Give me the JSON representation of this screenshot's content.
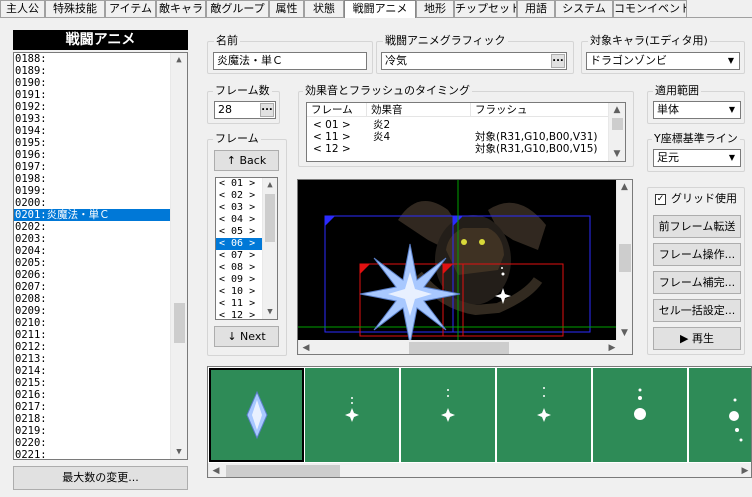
{
  "tabs": [
    "主人公",
    "特殊技能",
    "アイテム",
    "敵キャラ",
    "敵グループ",
    "属性",
    "状態",
    "戦闘アニメ",
    "地形",
    "チップセット",
    "用語",
    "システム",
    "コモンイベント"
  ],
  "active_tab": "戦闘アニメ",
  "left": {
    "title": "戦闘アニメ",
    "items": [
      "0188:",
      "0189:",
      "0190:",
      "0191:",
      "0192:",
      "0193:",
      "0194:",
      "0195:",
      "0196:",
      "0197:",
      "0198:",
      "0199:",
      "0200:",
      "0201:炎魔法・単Ｃ",
      "0202:",
      "0203:",
      "0204:",
      "0205:",
      "0206:",
      "0207:",
      "0208:",
      "0209:",
      "0210:",
      "0211:",
      "0212:",
      "0213:",
      "0214:",
      "0215:",
      "0216:",
      "0217:",
      "0218:",
      "0219:",
      "0220:",
      "0221:"
    ],
    "selected_index": 13,
    "max_button": "最大数の変更..."
  },
  "name": {
    "label": "名前",
    "value": "炎魔法・単Ｃ"
  },
  "graphic": {
    "label": "戦闘アニメグラフィック",
    "value": "冷気",
    "button": "..."
  },
  "target": {
    "label": "対象キャラ(エディタ用)",
    "value": "ドラゴンゾンビ"
  },
  "frame_count": {
    "label": "フレーム数",
    "value": "28",
    "button": "..."
  },
  "se_timing": {
    "label": "効果音とフラッシュのタイミング",
    "headers": [
      "フレーム",
      "効果音",
      "フラッシュ"
    ],
    "rows": [
      {
        "frame": "< 01 >",
        "sound": "炎2",
        "flash": ""
      },
      {
        "frame": "< 11 >",
        "sound": "炎4",
        "flash": "対象(R31,G10,B00,V31)"
      },
      {
        "frame": "< 12 >",
        "sound": "",
        "flash": "対象(R31,G10,B00,V15)"
      }
    ]
  },
  "scope": {
    "label": "適用範囲",
    "value": "単体"
  },
  "y_base": {
    "label": "Y座標基準ライン",
    "value": "足元"
  },
  "frame": {
    "label": "フレーム",
    "back": "↑ Back",
    "next": "↓ Next",
    "items": [
      "< 01 >",
      "< 02 >",
      "< 03 >",
      "< 04 >",
      "< 05 >",
      "< 06 >",
      "< 07 >",
      "< 08 >",
      "< 09 >",
      "< 10 >",
      "< 11 >",
      "< 12 >"
    ],
    "selected_index": 5
  },
  "grid": {
    "label": "グリッド使用",
    "checked": true
  },
  "buttons": {
    "prev_transfer": "前フレーム転送",
    "frame_ops": "フレーム操作...",
    "frame_interp": "フレーム補完...",
    "cell_batch": "セル一括設定...",
    "play": "▶ 再生"
  },
  "colors": {
    "selection": "#0078d7",
    "canvas_bg": "#000000",
    "cell_bg": "#2e8b57",
    "grid_blue": "#2b2bff",
    "grid_red": "#e01010",
    "grid_green": "#00a000"
  },
  "icons": [
    "chevron-up-icon",
    "chevron-down-icon",
    "chevron-left-icon",
    "chevron-right-icon",
    "ellipsis-icon",
    "check-icon",
    "play-icon",
    "star-burst-icon",
    "sparkle-icon"
  ]
}
